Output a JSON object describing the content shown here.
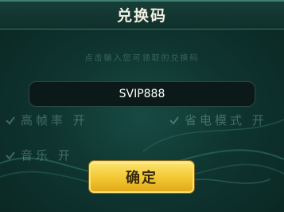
{
  "dialog": {
    "title": "兑换码"
  },
  "code_input": {
    "value": "SVIP888"
  },
  "confirm_button": {
    "label": "确定"
  },
  "background": {
    "hint": "点击输入您可领取的兑换码",
    "settings": [
      {
        "label": "高帧率 开"
      },
      {
        "label": "省电模式 开"
      },
      {
        "label": "音乐 开"
      }
    ]
  },
  "colors": {
    "accent_gold": "#f2c631",
    "panel_teal": "#0f3530",
    "input_bg": "#0b1a19"
  }
}
